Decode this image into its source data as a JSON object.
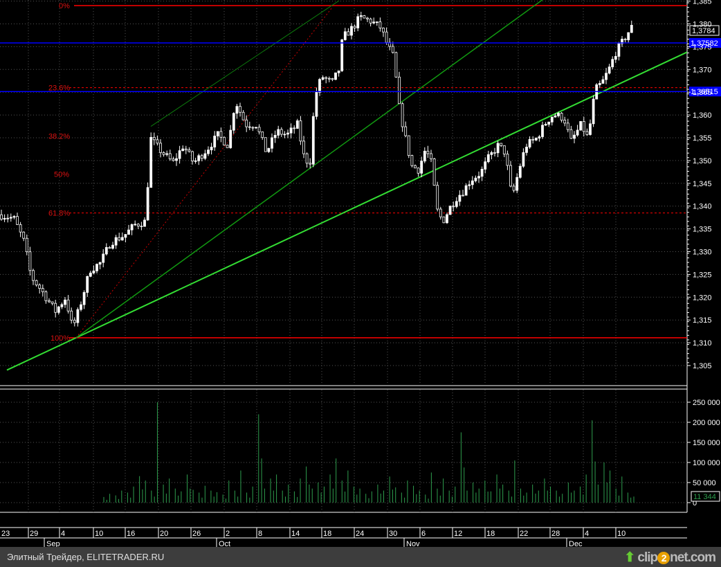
{
  "chart_data": {
    "type": "candlestick",
    "price_axis": {
      "min": 1.305,
      "max": 1.385,
      "ticks": [
        "1,305",
        "1,310",
        "1,315",
        "1,320",
        "1,325",
        "1,330",
        "1,335",
        "1,340",
        "1,345",
        "1,350",
        "1,355",
        "1,360",
        "1,365",
        "1,370",
        "1,375",
        "1,380",
        "1,385"
      ]
    },
    "current_price_label": "1,3784",
    "price_markers": [
      {
        "label": "1.37582",
        "price": 1.37582,
        "color": "#0000ff"
      },
      {
        "label": "1.36515",
        "price": 1.36515,
        "color": "#0000ff"
      }
    ],
    "fibonacci": {
      "color": "#ff0000",
      "levels": [
        {
          "label": "0%",
          "price": 1.384,
          "line": "solid"
        },
        {
          "label": "23.6%",
          "price": 1.366,
          "line": "dashed"
        },
        {
          "label": "38.2%",
          "price": 1.3554,
          "line": "none"
        },
        {
          "label": "50%",
          "price": 1.347,
          "line": "none"
        },
        {
          "label": "61.8%",
          "price": 1.3385,
          "line": "dashed"
        },
        {
          "label": "100%",
          "price": 1.3111,
          "line": "solid"
        }
      ]
    },
    "close_path": [
      [
        0,
        1.3381
      ],
      [
        20,
        1.3373
      ],
      [
        35,
        1.3321
      ],
      [
        45,
        1.3245
      ],
      [
        60,
        1.3215
      ],
      [
        80,
        1.3169
      ],
      [
        95,
        1.3199
      ],
      [
        105,
        1.3131
      ],
      [
        115,
        1.3177
      ],
      [
        130,
        1.326
      ],
      [
        145,
        1.3275
      ],
      [
        160,
        1.3321
      ],
      [
        180,
        1.3336
      ],
      [
        195,
        1.3359
      ],
      [
        210,
        1.3366
      ],
      [
        218,
        1.3548
      ],
      [
        230,
        1.3525
      ],
      [
        250,
        1.3495
      ],
      [
        265,
        1.3533
      ],
      [
        280,
        1.3495
      ],
      [
        300,
        1.3526
      ],
      [
        315,
        1.3556
      ],
      [
        330,
        1.3533
      ],
      [
        340,
        1.3632
      ],
      [
        355,
        1.3579
      ],
      [
        370,
        1.3579
      ],
      [
        385,
        1.3518
      ],
      [
        400,
        1.3564
      ],
      [
        415,
        1.3556
      ],
      [
        430,
        1.3579
      ],
      [
        440,
        1.3503
      ],
      [
        448,
        1.3495
      ],
      [
        455,
        1.364
      ],
      [
        465,
        1.3685
      ],
      [
        480,
        1.367
      ],
      [
        490,
        1.37
      ],
      [
        495,
        1.3769
      ],
      [
        510,
        1.3792
      ],
      [
        520,
        1.3814
      ],
      [
        535,
        1.3807
      ],
      [
        550,
        1.3792
      ],
      [
        560,
        1.3754
      ],
      [
        570,
        1.3723
      ],
      [
        575,
        1.3632
      ],
      [
        585,
        1.3556
      ],
      [
        595,
        1.3488
      ],
      [
        605,
        1.348
      ],
      [
        615,
        1.3526
      ],
      [
        625,
        1.3488
      ],
      [
        630,
        1.3396
      ],
      [
        640,
        1.3366
      ],
      [
        650,
        1.3396
      ],
      [
        660,
        1.3419
      ],
      [
        670,
        1.3434
      ],
      [
        680,
        1.3457
      ],
      [
        695,
        1.3473
      ],
      [
        705,
        1.3503
      ],
      [
        720,
        1.3533
      ],
      [
        730,
        1.3518
      ],
      [
        740,
        1.3417
      ],
      [
        750,
        1.348
      ],
      [
        760,
        1.3533
      ],
      [
        775,
        1.3548
      ],
      [
        790,
        1.3586
      ],
      [
        800,
        1.3601
      ],
      [
        815,
        1.3594
      ],
      [
        825,
        1.3541
      ],
      [
        840,
        1.3579
      ],
      [
        850,
        1.3548
      ],
      [
        860,
        1.3655
      ],
      [
        870,
        1.367
      ],
      [
        880,
        1.37
      ],
      [
        890,
        1.3738
      ],
      [
        900,
        1.3761
      ],
      [
        912,
        1.3792
      ]
    ],
    "trendlines": [
      {
        "name": "main-support",
        "color": "#33dd33",
        "from": [
          10,
          1.304
        ],
        "to": [
          993,
          1.3738
        ]
      },
      {
        "name": "channel-upper",
        "color": "#119911",
        "from": [
          110,
          1.3111
        ],
        "to": [
          785,
          1.3854
        ]
      },
      {
        "name": "channel-top-thin",
        "color": "#0c7a0c",
        "from": [
          218,
          1.3575
        ],
        "to": [
          490,
          1.3851
        ]
      },
      {
        "name": "fib-baseline",
        "color": "#cc0000",
        "from": [
          110,
          1.3111
        ],
        "to": [
          480,
          1.3836
        ]
      }
    ],
    "volume_axis": {
      "min": 0,
      "max": 250000,
      "ticks": [
        "0",
        "50 000",
        "100 000",
        "150 000",
        "200 000",
        "250 000"
      ]
    },
    "current_volume_label": "11 344",
    "volume": [
      14000,
      22000,
      18000,
      30000,
      25000,
      40000,
      66000,
      55000,
      30000,
      250000,
      45000,
      60000,
      35000,
      28000,
      70000,
      32000,
      25000,
      42000,
      30000,
      26000,
      20000,
      55000,
      30000,
      80000,
      25000,
      40000,
      220000,
      35000,
      60000,
      70000,
      30000,
      45000,
      28000,
      60000,
      90000,
      35000,
      50000,
      40000,
      70000,
      110000,
      55000,
      80000,
      40000,
      35000,
      22000,
      28000,
      45000,
      30000,
      65000,
      38000,
      25000,
      55000,
      42000,
      30000,
      20000,
      75000,
      35000,
      60000,
      30000,
      40000,
      175000,
      30000,
      50000,
      35000,
      55000,
      28000,
      70000,
      45000,
      30000,
      105000,
      35000,
      25000,
      45000,
      30000,
      60000,
      40000,
      30000,
      22000,
      50000,
      30000,
      40000,
      70000,
      205000,
      45000,
      100000,
      80000,
      35000,
      65000,
      25000,
      15000
    ],
    "x_axis": {
      "days": [
        "23",
        "29",
        "4",
        "10",
        "16",
        "20",
        "26",
        "2",
        "8",
        "14",
        "18",
        "24",
        "30",
        "6",
        "12",
        "18",
        "22",
        "28",
        "4",
        "10"
      ],
      "months": [
        "Sep",
        "Oct",
        "Nov",
        "Dec"
      ]
    }
  },
  "footer": {
    "caption": "Элитный Трейдер, ELITETRADER.RU",
    "logo": "clip2net.com"
  }
}
